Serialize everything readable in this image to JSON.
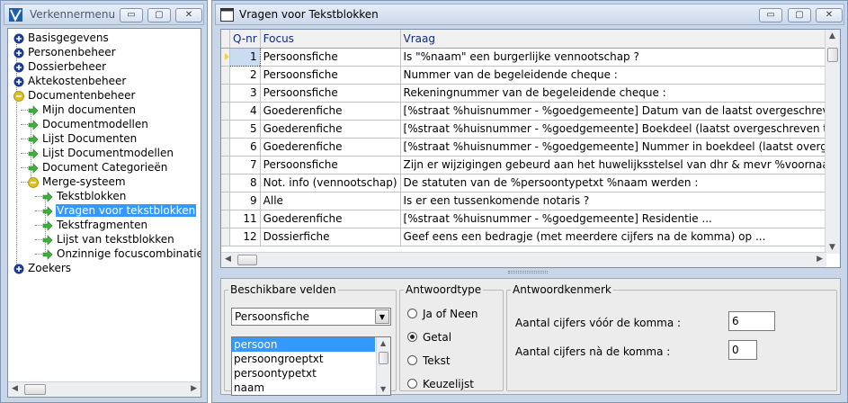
{
  "left_window": {
    "title": "Verkennermenu",
    "buttons": {
      "minimize": "▭",
      "restore": "▢",
      "close": "✕"
    },
    "tree": [
      {
        "label": "Basisgegevens",
        "icon": "plus-circle-icon",
        "level": 0
      },
      {
        "label": "Personenbeheer",
        "icon": "plus-circle-icon",
        "level": 0
      },
      {
        "label": "Dossierbeheer",
        "icon": "plus-circle-icon",
        "level": 0
      },
      {
        "label": "Aktekostenbeheer",
        "icon": "plus-circle-icon",
        "level": 0
      },
      {
        "label": "Documentenbeheer",
        "icon": "minus-circle-icon",
        "level": 0
      },
      {
        "label": "Mijn documenten",
        "icon": "green-arrow-icon",
        "level": 1
      },
      {
        "label": "Documentmodellen",
        "icon": "green-arrow-icon",
        "level": 1
      },
      {
        "label": "Lijst Documenten",
        "icon": "green-arrow-icon",
        "level": 1
      },
      {
        "label": "Lijst Documentmodellen",
        "icon": "green-arrow-icon",
        "level": 1
      },
      {
        "label": "Document Categorieën",
        "icon": "green-arrow-icon",
        "level": 1
      },
      {
        "label": "Merge-systeem",
        "icon": "minus-circle-icon",
        "level": 1
      },
      {
        "label": "Tekstblokken",
        "icon": "green-arrow-icon",
        "level": 2
      },
      {
        "label": "Vragen voor tekstblokken",
        "icon": "green-arrow-icon",
        "level": 2,
        "selected": true
      },
      {
        "label": "Tekstfragmenten",
        "icon": "green-arrow-icon",
        "level": 2
      },
      {
        "label": "Lijst van tekstblokken",
        "icon": "green-arrow-icon",
        "level": 2
      },
      {
        "label": "Onzinnige focuscombinaties",
        "icon": "green-arrow-icon",
        "level": 2
      },
      {
        "label": "Zoekers",
        "icon": "plus-circle-icon",
        "level": 0
      }
    ]
  },
  "right_window": {
    "title": "Vragen voor Tekstblokken",
    "buttons": {
      "minimize": "▭",
      "restore": "▢",
      "close": "✕"
    },
    "grid": {
      "columns": [
        "Q-nr",
        "Focus",
        "Vraag"
      ],
      "rows": [
        {
          "qnr": "1",
          "focus": "Persoonsfiche",
          "vraag": "Is \"%naam\" een burgerlijke vennootschap ?",
          "current": true
        },
        {
          "qnr": "2",
          "focus": "Persoonsfiche",
          "vraag": "Nummer van de begeleidende cheque :"
        },
        {
          "qnr": "3",
          "focus": "Persoonsfiche",
          "vraag": "Rekeningnummer van de begeleidende cheque :"
        },
        {
          "qnr": "4",
          "focus": "Goederenfiche",
          "vraag": "[%straat %huisnummer - %goedgemeente]  Datum van de laatst overgeschreven titel"
        },
        {
          "qnr": "5",
          "focus": "Goederenfiche",
          "vraag": "[%straat %huisnummer - %goedgemeente]  Boekdeel (laatst overgeschreven titel)"
        },
        {
          "qnr": "6",
          "focus": "Goederenfiche",
          "vraag": "[%straat %huisnummer - %goedgemeente]  Nummer in boekdeel (laatst overgeschreven titel)"
        },
        {
          "qnr": "7",
          "focus": "Persoonsfiche",
          "vraag": "Zijn er wijzigingen gebeurd aan het huwelijksstelsel van dhr & mevr %voornaam %naam"
        },
        {
          "qnr": "8",
          "focus": "Not. info (vennootschap)",
          "vraag": "De statuten van de %persoontypetxt %naam werden :"
        },
        {
          "qnr": "9",
          "focus": "Alle",
          "vraag": "Is er een tussenkomende notaris ?"
        },
        {
          "qnr": "11",
          "focus": "Goederenfiche",
          "vraag": "[%straat %huisnummer - %goedgemeente]  Residentie ..."
        },
        {
          "qnr": "12",
          "focus": "Dossierfiche",
          "vraag": "Geef eens een bedragje (met meerdere cijfers na de komma) op ..."
        }
      ]
    },
    "beschikbare_velden": {
      "legend": "Beschikbare velden",
      "selected": "Persoonsfiche",
      "fields": [
        "persoon",
        "persoongroeptxt",
        "persoontypetxt",
        "naam"
      ]
    },
    "antwoordtype": {
      "legend": "Antwoordtype",
      "options": [
        {
          "label": "Ja of Neen",
          "checked": false
        },
        {
          "label": "Getal",
          "checked": true
        },
        {
          "label": "Tekst",
          "checked": false
        },
        {
          "label": "Keuzelijst",
          "checked": false
        }
      ]
    },
    "antwoordkenmerk": {
      "legend": "Antwoordkenmerk",
      "voor_label": "Aantal cijfers vóór de komma :",
      "voor_value": "6",
      "na_label": "Aantal cijfers nà de komma :",
      "na_value": "0"
    }
  },
  "colors": {
    "selection": "#3399ff",
    "window_frame": "#c8d6e8",
    "header_text": "#102a7a"
  }
}
